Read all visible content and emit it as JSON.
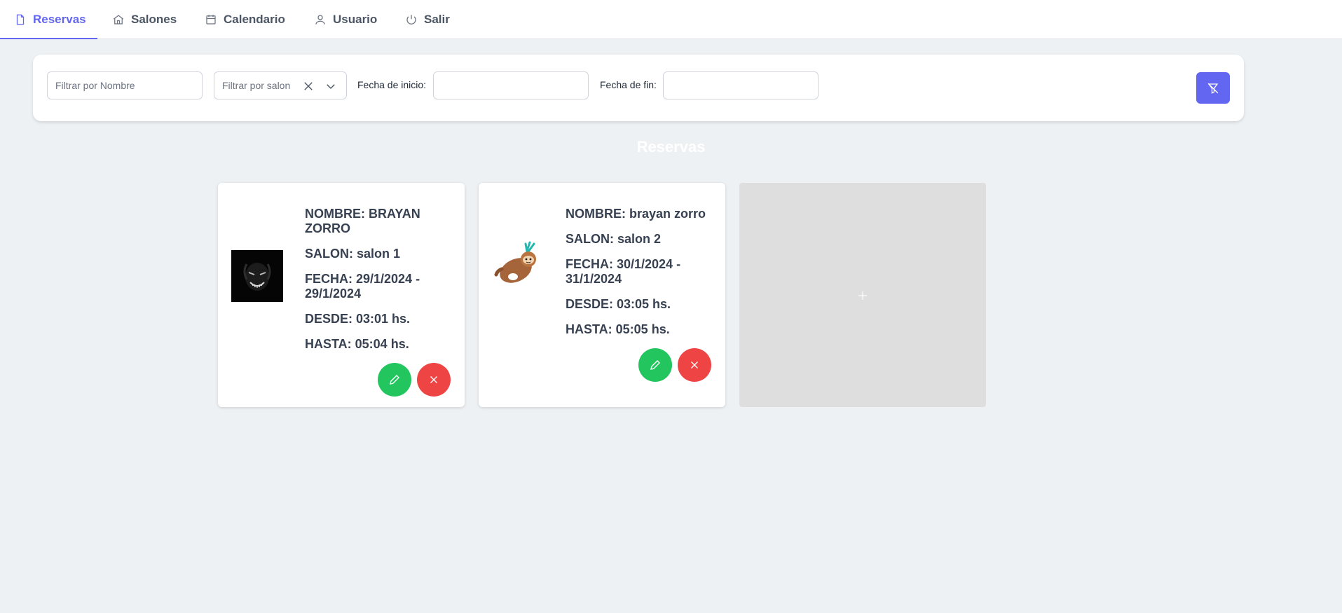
{
  "nav": {
    "tabs": [
      {
        "label": "Reservas",
        "icon": "file-icon",
        "active": true
      },
      {
        "label": "Salones",
        "icon": "home-icon",
        "active": false
      },
      {
        "label": "Calendario",
        "icon": "calendar-icon",
        "active": false
      },
      {
        "label": "Usuario",
        "icon": "user-icon",
        "active": false
      },
      {
        "label": "Salir",
        "icon": "power-icon",
        "active": false
      }
    ],
    "accent_color": "#6366f1"
  },
  "filters": {
    "name_placeholder": "Filtrar por Nombre",
    "salon_placeholder": "Filtrar por salon",
    "start_label": "Fecha de inicio:",
    "end_label": "Fecha de fin:",
    "start_value": "",
    "end_value": "",
    "filter_button_icon": "filter-off-icon"
  },
  "section_title": "Reservas",
  "reservations": [
    {
      "image": "dark-creature-avatar",
      "nombre": "NOMBRE: BRAYAN ZORRO",
      "salon": "SALON: salon 1",
      "fecha": "FECHA: 29/1/2024 - 29/1/2024",
      "desde": "DESDE: 03:01 hs.",
      "hasta": "HASTA: 05:04 hs."
    },
    {
      "image": "sloth-sticker-avatar",
      "nombre": "NOMBRE: brayan zorro",
      "salon": "SALON: salon 2",
      "fecha": "FECHA: 30/1/2024 - 31/1/2024",
      "desde": "DESDE: 03:05 hs.",
      "hasta": "HASTA: 05:05 hs."
    }
  ],
  "colors": {
    "edit": "#22c55e",
    "delete": "#ef4444",
    "background": "#eef1f4",
    "add_card": "#dedede"
  }
}
